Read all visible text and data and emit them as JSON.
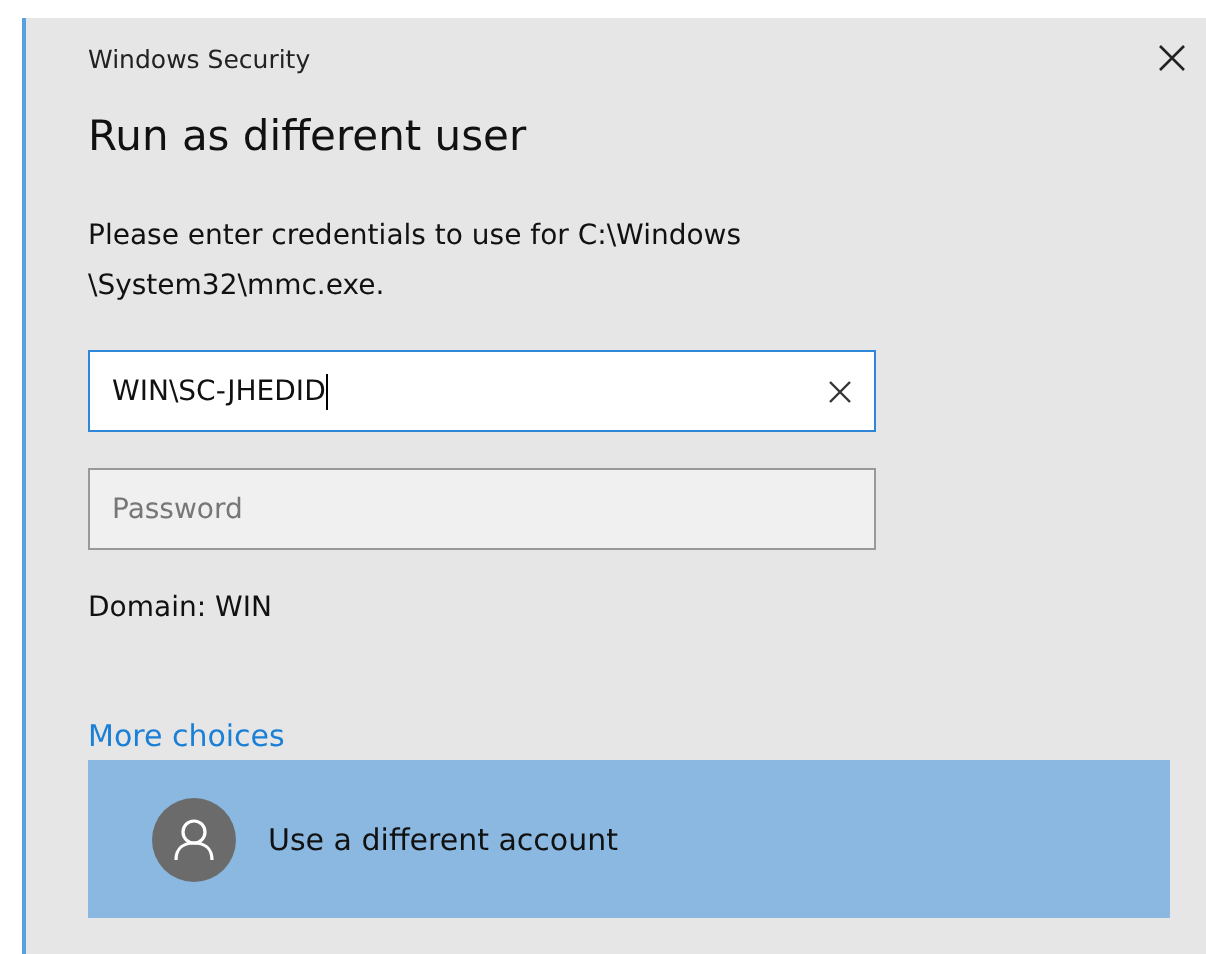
{
  "window": {
    "title": "Windows Security"
  },
  "heading": "Run as different user",
  "message": "Please enter credentials to use for C:\\Windows \\System32\\mmc.exe.",
  "username": {
    "value": "WIN\\SC-JHEDID",
    "focused": true
  },
  "password": {
    "placeholder": "Password"
  },
  "domain": "Domain: WIN",
  "more_choices": "More choices",
  "accounts": [
    {
      "label": "Use a different account",
      "selected": true
    }
  ]
}
